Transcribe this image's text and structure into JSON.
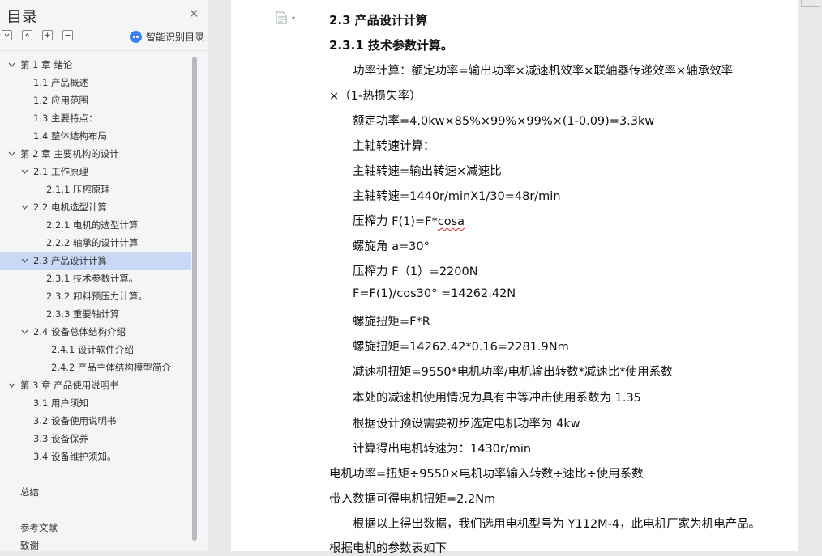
{
  "sidebar": {
    "title": "目录",
    "close_icon": "close-icon",
    "tools": [
      "collapse-all-icon",
      "expand-icon",
      "add-heading-icon",
      "remove-heading-icon"
    ],
    "smart_label": "智能识别目录",
    "toc": [
      {
        "label": "第 1 章  绪论",
        "level": 0,
        "chevron": true
      },
      {
        "label": "1.1 产品概述",
        "level": 1,
        "chevron": false
      },
      {
        "label": "1.2  应用范围",
        "level": 1,
        "chevron": false
      },
      {
        "label": "1.3 主要特点：",
        "level": 1,
        "chevron": false
      },
      {
        "label": "1.4  整体结构布局",
        "level": 1,
        "chevron": false
      },
      {
        "label": "第 2 章  主要机构的设计",
        "level": 0,
        "chevron": true
      },
      {
        "label": "2.1 工作原理",
        "level": 1,
        "chevron": true
      },
      {
        "label": "2.1.1 压榨原理",
        "level": 2,
        "chevron": false
      },
      {
        "label": "2.2 电机选型计算",
        "level": 1,
        "chevron": true
      },
      {
        "label": "2.2.1 电机的选型计算",
        "level": 2,
        "chevron": false
      },
      {
        "label": "2.2.2 轴承的设计计算",
        "level": 2,
        "chevron": false
      },
      {
        "label": "2.3  产品设计计算",
        "level": 1,
        "chevron": true,
        "active": true
      },
      {
        "label": "2.3.1  技术参数计算。",
        "level": 2,
        "chevron": false
      },
      {
        "label": "2.3.2  卸料预压力计算。",
        "level": 2,
        "chevron": false
      },
      {
        "label": "2.3.3  重要轴计算",
        "level": 2,
        "chevron": false
      },
      {
        "label": "2.4 设备总体结构介绍",
        "level": 1,
        "chevron": true
      },
      {
        "label": "2.4.1 设计软件介绍",
        "level": 3,
        "chevron": false
      },
      {
        "label": "2.4.2 产品主体结构模型简介",
        "level": 3,
        "chevron": false
      },
      {
        "label": "第 3 章  产品使用说明书",
        "level": 0,
        "chevron": true
      },
      {
        "label": "3.1  用户须知",
        "level": 1,
        "chevron": false
      },
      {
        "label": "3.2  设备使用说明书",
        "level": 1,
        "chevron": false
      },
      {
        "label": "3.3  设备保养",
        "level": 1,
        "chevron": false
      },
      {
        "label": "3.4 设备维护须知。",
        "level": 1,
        "chevron": false
      },
      {
        "label": "",
        "level": -1,
        "chevron": false
      },
      {
        "label": "总结",
        "level": 0,
        "chevron": false,
        "nochev": true
      },
      {
        "label": "",
        "level": -1,
        "chevron": false
      },
      {
        "label": "参考文献",
        "level": 0,
        "chevron": false,
        "nochev": true
      },
      {
        "label": "致谢",
        "level": 0,
        "chevron": false,
        "nochev": true
      }
    ]
  },
  "document": {
    "lines": [
      {
        "text": "2.3  产品设计计算",
        "style": "h",
        "indent": false
      },
      {
        "text": "2.3.1  技术参数计算。",
        "style": "h",
        "indent": false
      },
      {
        "text": "功率计算：额定功率=输出功率×减速机效率×联轴器传递效率×轴承效率",
        "style": "",
        "indent": true
      },
      {
        "text": "×（1-热损失率）",
        "style": "",
        "indent": false
      },
      {
        "text": "额定功率=4.0kw×85%×99%×99%×(1-0.09)=3.3kw",
        "style": "",
        "indent": true
      },
      {
        "text": "主轴转速计算：",
        "style": "",
        "indent": true
      },
      {
        "text": "主轴转速=输出转速×减速比",
        "style": "",
        "indent": true
      },
      {
        "text": "主轴转速=1440r/minX1/30=48r/min",
        "style": "",
        "indent": true
      },
      {
        "text": "压榨力 F(1)=F*cosa",
        "style": "",
        "indent": true,
        "squiggle_tail": "cosa"
      },
      {
        "text": "螺旋角 a=30°",
        "style": "",
        "indent": true
      },
      {
        "text": "压榨力 F（1）=2200N",
        "style": "",
        "indent": true
      },
      {
        "text": "F=F(1)/cos30° =14262.42N",
        "style": "",
        "indent": true
      },
      {
        "text": "螺旋扭矩=F*R",
        "style": "",
        "indent": true
      },
      {
        "text": "螺旋扭矩=14262.42*0.16=2281.9Nm",
        "style": "",
        "indent": true
      },
      {
        "text": "减速机扭矩=9550*电机功率/电机输出转数*减速比*使用系数",
        "style": "",
        "indent": true
      },
      {
        "text": "本处的减速机使用情况为具有中等冲击使用系数为 1.35",
        "style": "",
        "indent": true
      },
      {
        "text": "根据设计预设需要初步选定电机功率为 4kw",
        "style": "",
        "indent": true
      },
      {
        "text": "计算得出电机转速为：1430r/min",
        "style": "",
        "indent": true
      },
      {
        "text": "电机功率=扭矩÷9550×电机功率输入转数÷速比÷使用系数",
        "style": "",
        "indent": false
      },
      {
        "text": "带入数据可得电机扭矩=2.2Nm",
        "style": "",
        "indent": false
      },
      {
        "text": "根据以上得出数据，我们选用电机型号为 Y112M-4，此电机厂家为机电产品。",
        "style": "",
        "indent": true
      },
      {
        "text": "根据电机的参数表如下",
        "style": "",
        "indent": false
      }
    ]
  }
}
